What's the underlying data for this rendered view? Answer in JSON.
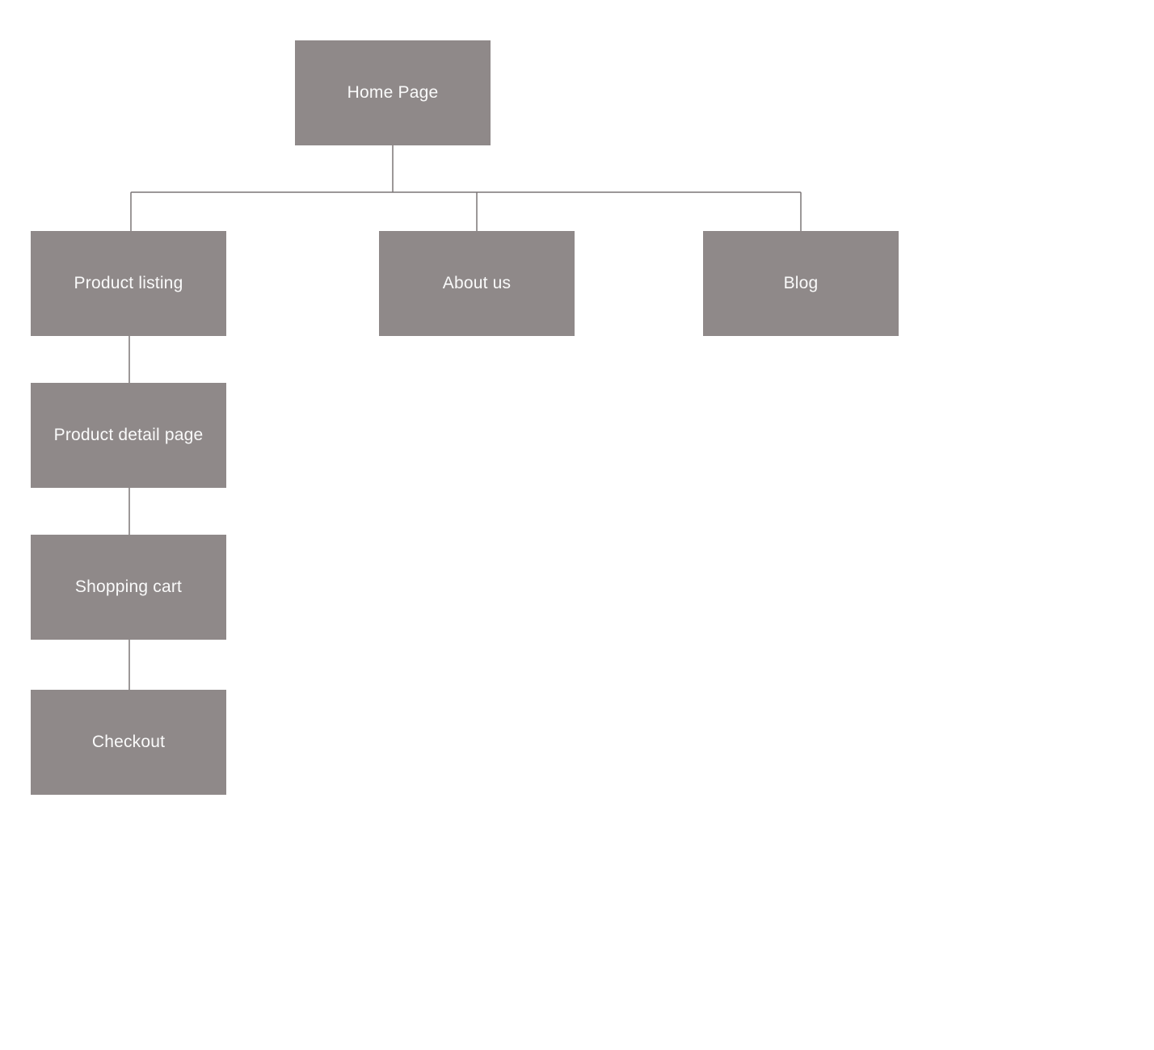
{
  "colors": {
    "node_bg": "#8f8989",
    "node_text": "#fafafa",
    "connector": "#7a7576"
  },
  "diagram": {
    "root": {
      "label": "Home Page"
    },
    "children": [
      {
        "label": "Product listing"
      },
      {
        "label": "About us"
      },
      {
        "label": "Blog"
      }
    ],
    "product_chain": [
      {
        "label": "Product detail page"
      },
      {
        "label": "Shopping cart"
      },
      {
        "label": "Checkout"
      }
    ]
  }
}
